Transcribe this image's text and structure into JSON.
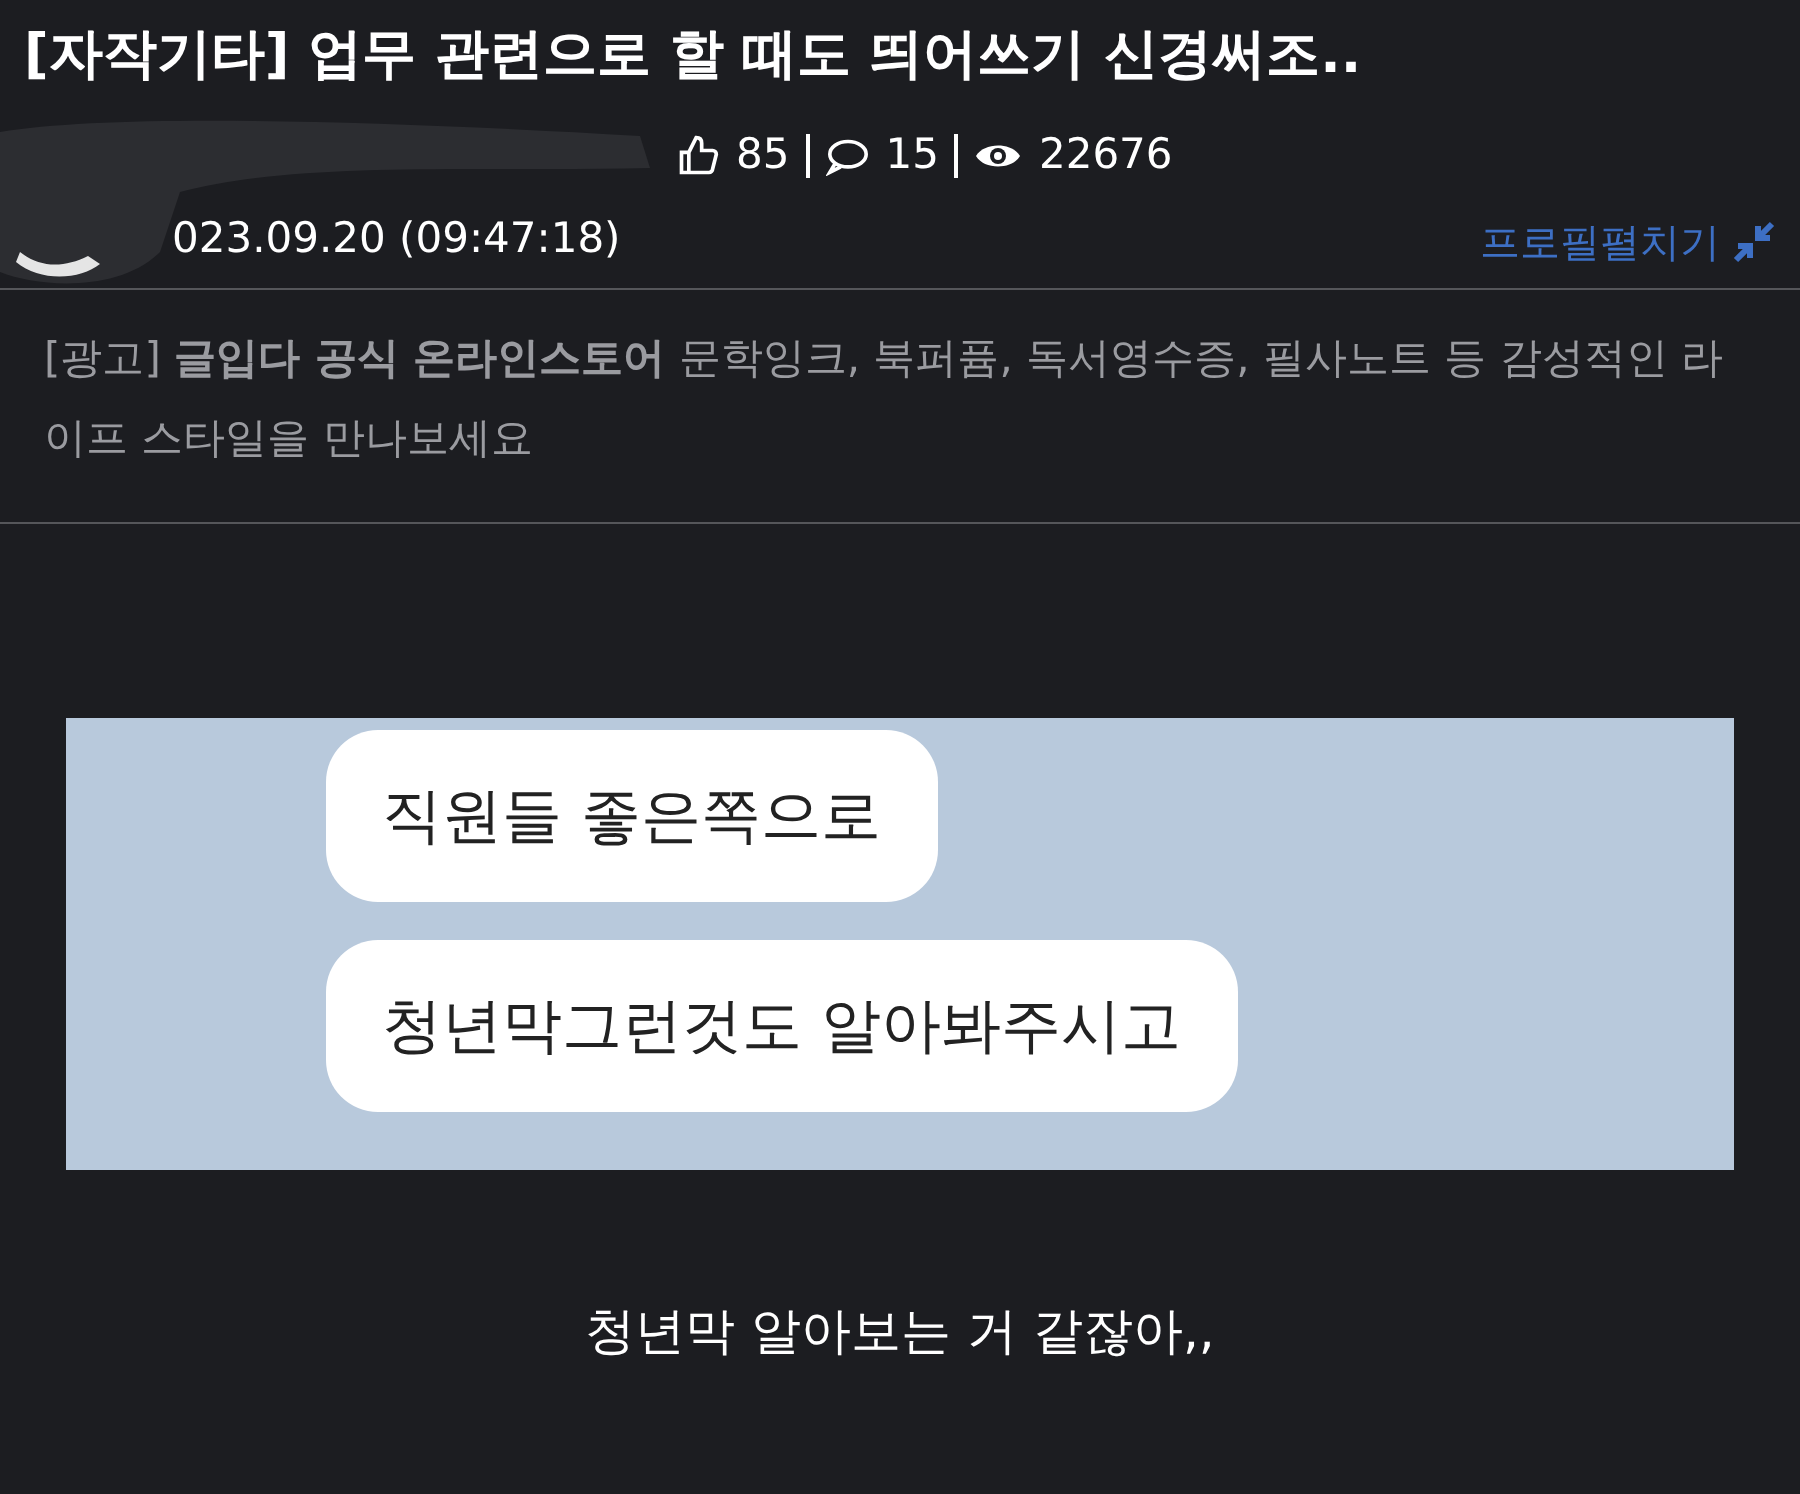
{
  "post": {
    "category": "[자작기타]",
    "title": "업무 관련으로 할 때도 띄어쓰기 신경써조..",
    "likes": "85",
    "comments": "15",
    "views": "22676",
    "date": "023.09.20 (09:47:18)",
    "profile_toggle": "프로필펼치기"
  },
  "ad": {
    "text": "[광고] **글입다 공식 온라인스토어** 문학잉크, 북퍼퓸, 독서영수증, 필사노트 등 감성적인 라이프 스타일을 만나보세요"
  },
  "chat_bubbles": [
    {
      "text": "직원들 좋은쪽으로"
    },
    {
      "text": "청년막그런것도 알아봐주시고"
    }
  ],
  "caption": "청년막 알아보는 거 같잖아,,"
}
